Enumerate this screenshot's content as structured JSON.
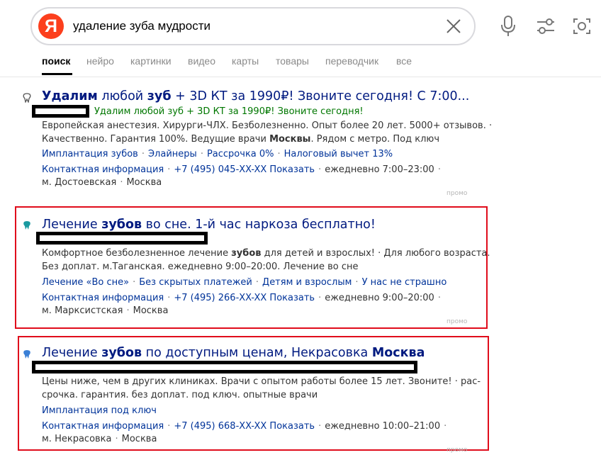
{
  "search": {
    "logo_letter": "Я",
    "query": "удаление зуба мудрости"
  },
  "tabs": [
    "поиск",
    "нейро",
    "картинки",
    "видео",
    "карты",
    "товары",
    "переводчик",
    "все"
  ],
  "ads": [
    {
      "title_bold": "Удалим",
      "title_rest": " любой ",
      "title_bold2": "зуб",
      "title_end": " + 3D КТ за 1990₽! Звоните сегодня! С 7:00...",
      "sub": "Удалим любой зуб + 3D КТ за 1990₽! Звоните сегодня!",
      "desc1": "Европейская анестезия. Хирурги-ЧЛХ. Безболезненно. Опыт более 20 лет. 5000+ отзывов. ·",
      "desc2a": "Качественно. Гарантия 100%. Ведущие врачи ",
      "desc2b": "Москвы",
      "desc2c": ". Рядом с метро. Под ключ",
      "links": [
        "Имплантация зубов",
        "Элайнеры",
        "Рассрочка 0%",
        "Налоговый вычет 13%"
      ],
      "contact_label": "Контактная информация",
      "phone": "+7 (495) 045-XX-XX Показать",
      "hours": "ежедневно 7:00–23:00",
      "metro": "м. Достоевская",
      "city": "Москва",
      "promo": "промо"
    },
    {
      "title_a": "Лечение ",
      "title_b": "зубов",
      "title_c": " во сне. 1-й час наркоза бесплатно!",
      "desc1a": "Комфортное безболезненное лечение ",
      "desc1b": "зубов",
      "desc1c": " для детей и взрослых! · Для любого возраста.",
      "desc2": "Без доплат. м.Таганская. ежедневно 9:00–20:00. Лечение во сне",
      "links": [
        "Лечение «Во сне»",
        "Без скрытых платежей",
        "Детям и взрослым",
        "У нас не страшно"
      ],
      "contact_label": "Контактная информация",
      "phone": "+7 (495) 266-XX-XX Показать",
      "hours": "ежедневно 9:00–20:00",
      "metro": "м. Марксистская",
      "city": "Москва",
      "promo": "промо"
    },
    {
      "title_a": "Лечение ",
      "title_b": "зубов",
      "title_c": " по доступным ценам, Некрасовка ",
      "title_d": "Москва",
      "desc1": "Цены ниже, чем в других клиниках. Врачи с опытом работы более 15 лет. Звоните! · рас-",
      "desc2": "срочка. гарантия. без доплат. под ключ. опытные врачи",
      "links": [
        "Имплантация под ключ"
      ],
      "contact_label": "Контактная информация",
      "phone": "+7 (495) 668-XX-XX Показать",
      "hours": "ежедневно 10:00–21:00",
      "metro": "м. Некрасовка",
      "city": "Москва",
      "promo": "промо"
    }
  ],
  "colors": {
    "brand": "#fc3f1d",
    "title": "#001a80",
    "link": "#003399",
    "url_green": "#007700",
    "highlight_frame": "#e00c1b"
  },
  "icons": [
    "clear-icon",
    "microphone-icon",
    "filters-icon",
    "camera-search-icon",
    "tooth-favicon"
  ]
}
